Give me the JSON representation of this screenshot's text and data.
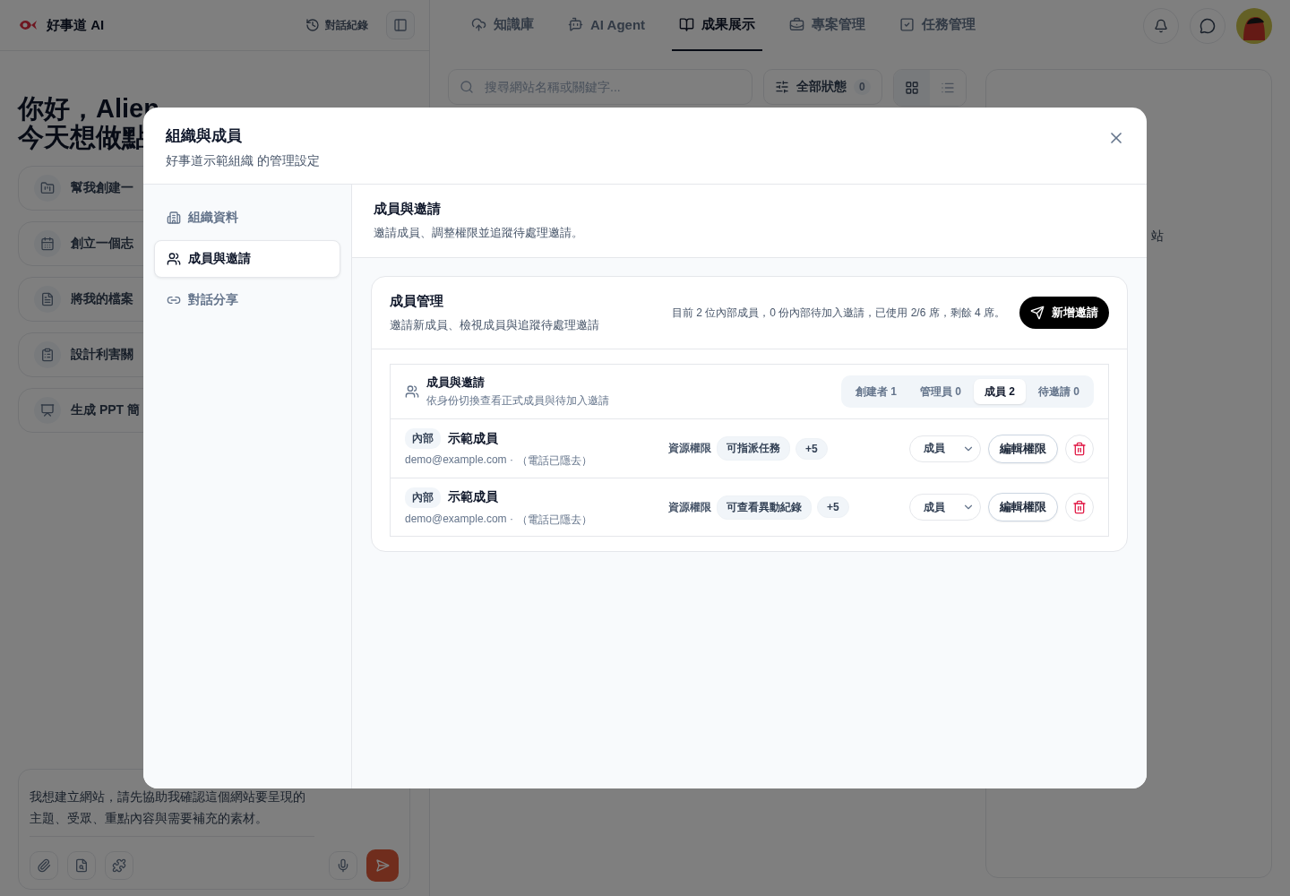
{
  "sidebar": {
    "brand": "好事道 AI",
    "history_button": "對話紀錄",
    "greeting": [
      "你好，Alien",
      "今天想做點"
    ],
    "suggestions": [
      {
        "kind": "folder",
        "text": "幫我創建一"
      },
      {
        "kind": "calendar",
        "text": "創立一個志"
      },
      {
        "kind": "file",
        "text": "將我的檔案"
      },
      {
        "kind": "clipboard",
        "text": "設計利害關"
      },
      {
        "kind": "presentation",
        "text": "生成 PPT 簡"
      }
    ],
    "composer": {
      "value": "我想建立網站，請先協助我確認這個網站要呈現的主題、受眾、重點內容與需要補充的素材。"
    }
  },
  "nav": {
    "tabs": [
      {
        "kind": "upload",
        "label": "知識庫",
        "selected": false
      },
      {
        "kind": "agent",
        "label": "AI Agent",
        "selected": false
      },
      {
        "kind": "book",
        "label": "成果展示",
        "selected": true
      },
      {
        "kind": "briefcase",
        "label": "專案管理",
        "selected": false
      },
      {
        "kind": "check",
        "label": "任務管理",
        "selected": false
      }
    ]
  },
  "toolbar": {
    "search": {
      "placeholder": "搜尋網站名稱或關鍵字..."
    },
    "filter": {
      "label": "全部狀態",
      "count": "0"
    },
    "views": [
      {
        "kind": "grid",
        "selected": true
      },
      {
        "kind": "list",
        "selected": false
      }
    ]
  },
  "side_card": {
    "text": "站"
  },
  "modal": {
    "title": "組織與成員",
    "subtitle": "好事道示範組織 的管理設定",
    "menu": [
      {
        "kind": "building",
        "label": "組織資料",
        "selected": false
      },
      {
        "kind": "users",
        "label": "成員與邀請",
        "selected": true
      },
      {
        "kind": "link",
        "label": "對話分享",
        "selected": false
      }
    ],
    "section": {
      "title": "成員與邀請",
      "subtitle": "邀請成員、調整權限並追蹤待處理邀請。"
    },
    "card": {
      "title": "成員管理",
      "subtitle": "邀請新成員、檢視成員與追蹤待處理邀請",
      "summary": "目前 2 位內部成員，0 份內部待加入邀請，已使用 2/6 席，剩餘 4 席。",
      "invite_button": "新增邀請",
      "list": {
        "title": "成員與邀請",
        "subtitle": "依身份切換查看正式成員與待加入邀請",
        "filters": [
          {
            "label": "創建者 1",
            "selected": false
          },
          {
            "label": "管理員 0",
            "selected": false
          },
          {
            "label": "成員 2",
            "selected": true
          },
          {
            "label": "待邀請 0",
            "selected": false
          }
        ],
        "members": [
          {
            "tag": "內部",
            "name": "示範成員",
            "email": "demo@example.com ·",
            "phone": "（電話已隱去）",
            "perm_label": "資源權限",
            "perm": "可指派任務",
            "more": "+5",
            "role": "成員",
            "edit_button": "編輯權限"
          },
          {
            "tag": "內部",
            "name": "示範成員",
            "email": "demo@example.com ·",
            "phone": "（電話已隱去）",
            "perm_label": "資源權限",
            "perm": "可查看異動紀錄",
            "more": "+5",
            "role": "成員",
            "edit_button": "編輯權限"
          }
        ]
      }
    }
  }
}
